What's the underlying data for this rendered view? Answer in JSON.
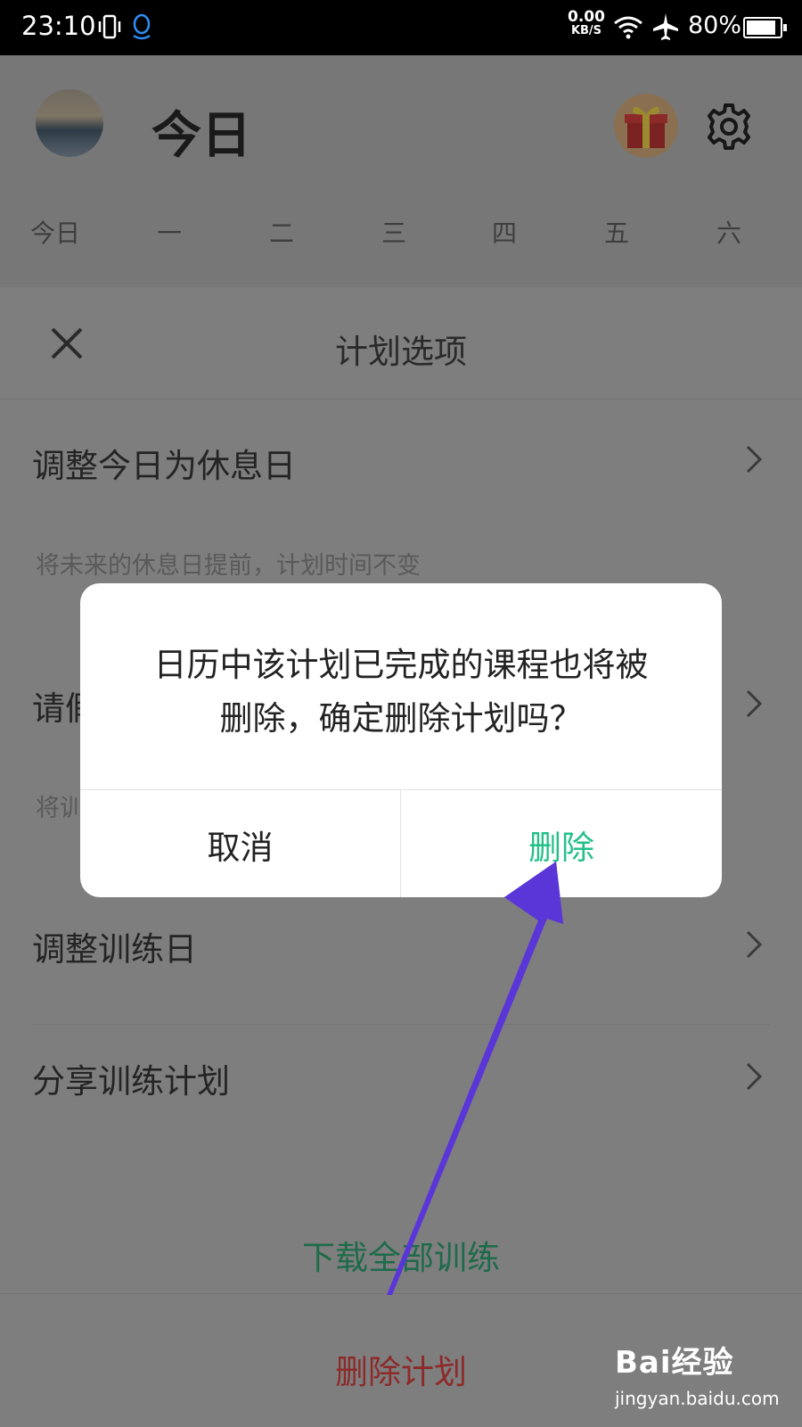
{
  "status_bar": {
    "time": "23:10",
    "net_speed": "0.00",
    "net_unit": "KB/S",
    "battery": "80%",
    "icons": [
      "vibrate-icon",
      "qq-icon",
      "wifi-icon",
      "airplane-icon",
      "battery-icon"
    ]
  },
  "header": {
    "title": "今日",
    "weekdays": [
      "今日",
      "一",
      "二",
      "三",
      "四",
      "五",
      "六"
    ]
  },
  "sheet": {
    "title": "计划选项",
    "options": [
      {
        "label": "调整今日为休息日",
        "sub": "将未来的休息日提前，计划时间不变"
      },
      {
        "label": "请假",
        "sub": "将训"
      },
      {
        "label": "调整训练日",
        "sub": ""
      },
      {
        "label": "分享训练计划",
        "sub": ""
      }
    ],
    "download_label": "下载全部训练",
    "delete_plan_label": "删除计划"
  },
  "dialog": {
    "message_line1": "日历中该计划已完成的课程也将被",
    "message_line2": "删除，确定删除计划吗？",
    "cancel_label": "取消",
    "delete_label": "删除"
  },
  "colors": {
    "confirm_green": "#24c08a",
    "danger_red": "#8d2a2a",
    "annotation_arrow": "#5a36d8"
  },
  "watermark": {
    "logo": "Bai经验",
    "url": "jingyan.baidu.com"
  }
}
